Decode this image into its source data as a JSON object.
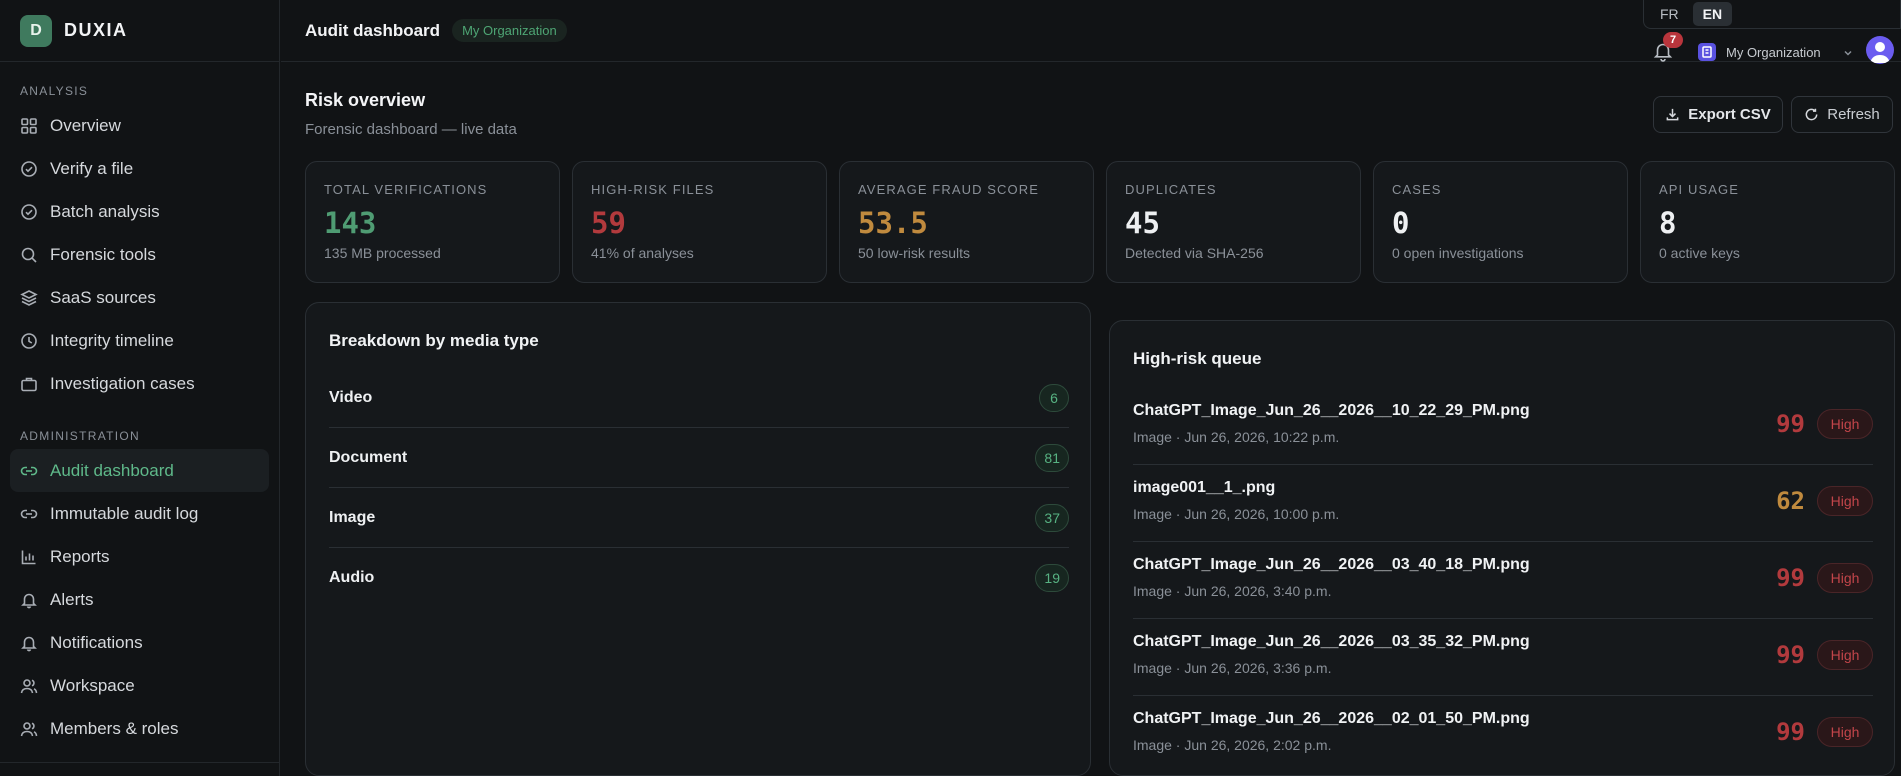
{
  "brand": {
    "logo_letter": "D",
    "name": "DUXIA"
  },
  "sidebar": {
    "analysis_title": "ANALYSIS",
    "analysis_items": [
      {
        "label": "Overview",
        "icon": "grid-icon"
      },
      {
        "label": "Verify a file",
        "icon": "check-circle-icon"
      },
      {
        "label": "Batch analysis",
        "icon": "check-circle-icon"
      },
      {
        "label": "Forensic tools",
        "icon": "search-icon"
      },
      {
        "label": "SaaS sources",
        "icon": "layers-icon"
      },
      {
        "label": "Integrity timeline",
        "icon": "clock-icon"
      },
      {
        "label": "Investigation cases",
        "icon": "briefcase-icon"
      }
    ],
    "admin_title": "ADMINISTRATION",
    "admin_items": [
      {
        "label": "Audit dashboard",
        "icon": "link-icon",
        "active": true
      },
      {
        "label": "Immutable audit log",
        "icon": "link-icon"
      },
      {
        "label": "Reports",
        "icon": "bar-chart-icon"
      },
      {
        "label": "Alerts",
        "icon": "bell-icon"
      },
      {
        "label": "Notifications",
        "icon": "bell-icon"
      },
      {
        "label": "Workspace",
        "icon": "users-icon"
      },
      {
        "label": "Members & roles",
        "icon": "users-icon"
      }
    ]
  },
  "topbar": {
    "title": "Audit dashboard",
    "org_badge": "My Organization",
    "languages": [
      "FR",
      "EN"
    ],
    "active_language": "EN",
    "notification_count": "7",
    "workspace_name": "My Organization"
  },
  "page": {
    "title": "Risk overview",
    "subtitle": "Forensic dashboard — live data",
    "export_label": "Export CSV",
    "refresh_label": "Refresh"
  },
  "stats": [
    {
      "label": "TOTAL VERIFICATIONS",
      "value": "143",
      "sub": "135 MB processed",
      "tone": "green"
    },
    {
      "label": "HIGH-RISK FILES",
      "value": "59",
      "sub": "41% of analyses",
      "tone": "red"
    },
    {
      "label": "AVERAGE FRAUD SCORE",
      "value": "53.5",
      "sub": "50 low-risk results",
      "tone": "amber"
    },
    {
      "label": "DUPLICATES",
      "value": "45",
      "sub": "Detected via SHA-256",
      "tone": "white"
    },
    {
      "label": "CASES",
      "value": "0",
      "sub": "0 open investigations",
      "tone": "white"
    },
    {
      "label": "API USAGE",
      "value": "8",
      "sub": "0 active keys",
      "tone": "white"
    }
  ],
  "media_breakdown": {
    "title": "Breakdown by media type",
    "rows": [
      {
        "name": "Video",
        "count": "6"
      },
      {
        "name": "Document",
        "count": "81"
      },
      {
        "name": "Image",
        "count": "37"
      },
      {
        "name": "Audio",
        "count": "19"
      }
    ]
  },
  "risk_queue": {
    "title": "High-risk queue",
    "items": [
      {
        "file": "ChatGPT_Image_Jun_26__2026__10_22_29_PM.png",
        "meta": "Image · Jun 26, 2026, 10:22 p.m.",
        "score": "99",
        "level": "High",
        "score_color": "#b23a3d"
      },
      {
        "file": "image001__1_.png",
        "meta": "Image · Jun 26, 2026, 10:00 p.m.",
        "score": "62",
        "level": "High",
        "score_color": "#c08a3e"
      },
      {
        "file": "ChatGPT_Image_Jun_26__2026__03_40_18_PM.png",
        "meta": "Image · Jun 26, 2026, 3:40 p.m.",
        "score": "99",
        "level": "High",
        "score_color": "#b23a3d"
      },
      {
        "file": "ChatGPT_Image_Jun_26__2026__03_35_32_PM.png",
        "meta": "Image · Jun 26, 2026, 3:36 p.m.",
        "score": "99",
        "level": "High",
        "score_color": "#b23a3d"
      },
      {
        "file": "ChatGPT_Image_Jun_26__2026__02_01_50_PM.png",
        "meta": "Image · Jun 26, 2026, 2:02 p.m.",
        "score": "99",
        "level": "High",
        "score_color": "#b23a3d"
      }
    ]
  }
}
